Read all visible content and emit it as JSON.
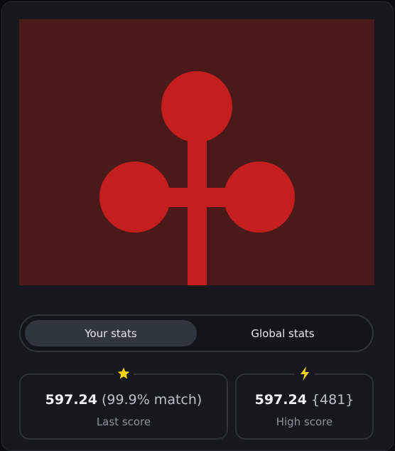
{
  "colors": {
    "preview_bg": "#4a191a",
    "shape_red": "#c51e1e",
    "star_yellow": "#f5d20c",
    "bolt_yellow": "#f5d20c"
  },
  "tabs": {
    "your_stats": "Your stats",
    "global_stats": "Global stats",
    "active": "your_stats"
  },
  "last_score": {
    "icon": "star-icon",
    "value": "597.24",
    "extra": "(99.9% match)",
    "label": "Last score"
  },
  "high_score": {
    "icon": "lightning-icon",
    "value": "597.24",
    "extra": "{481}",
    "label": "High score"
  }
}
